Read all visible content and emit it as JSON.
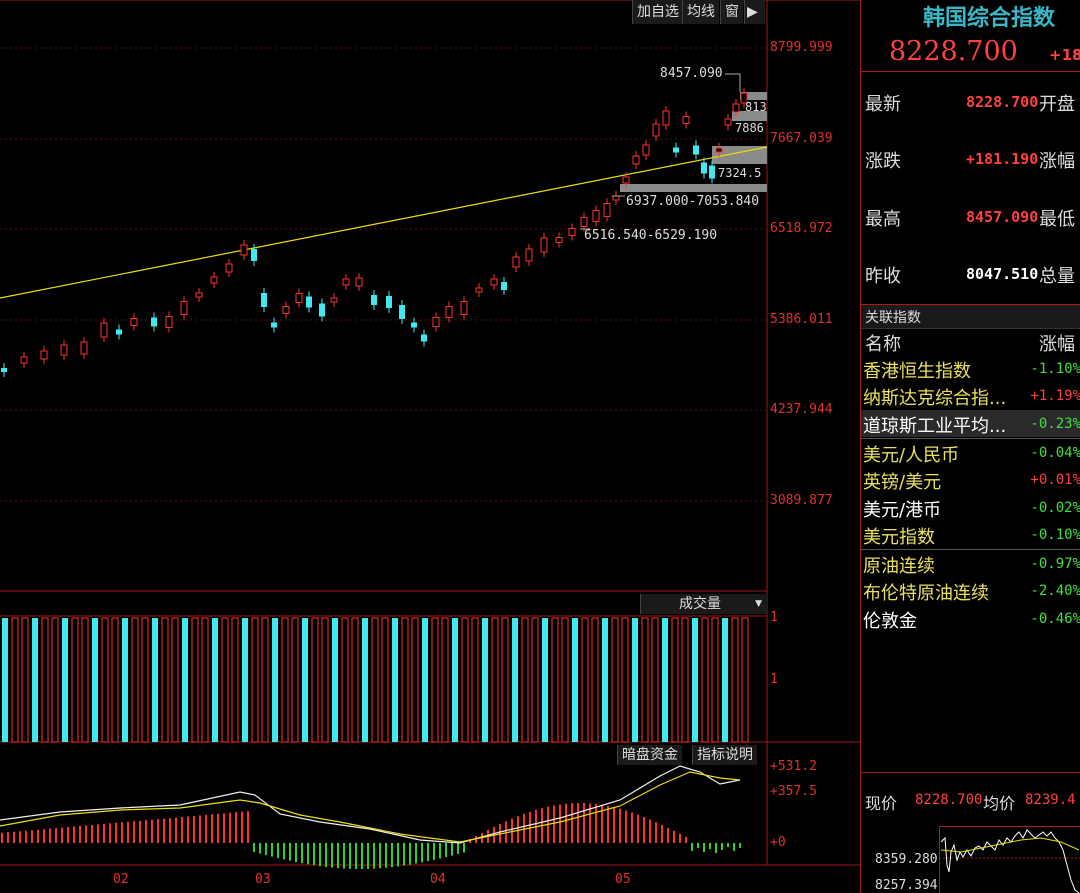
{
  "toolbar": {
    "add_watch": "加自选",
    "ma": "均线",
    "window": "窗"
  },
  "main_chart": {
    "price_axis": [
      "8799.999",
      "7667.039",
      "6518.972",
      "5386.011",
      "4237.944",
      "3089.877"
    ],
    "annotations": {
      "high": "8457.090",
      "gap1": "813",
      "gap2": "7886",
      "gap3": "7324.5",
      "gap4": "6937.000-7053.840",
      "gap5": "6516.540-6529.190"
    }
  },
  "volume_panel": {
    "selector": "成交量",
    "ticks": [
      "1",
      "1"
    ]
  },
  "indicator_panel": {
    "buttons": [
      "暗盘资金",
      "指标说明"
    ],
    "ticks": [
      "+531.2",
      "+357.5",
      "+0"
    ]
  },
  "x_axis": [
    "02",
    "03",
    "04",
    "05"
  ],
  "quote": {
    "title": "韩国综合指数",
    "price": "8228.700",
    "change_partial": "+18",
    "rows": [
      {
        "label": "最新",
        "value": "8228.700",
        "label2": "开盘"
      },
      {
        "label": "涨跌",
        "value": "+181.190",
        "label2": "涨幅"
      },
      {
        "label": "最高",
        "value": "8457.090",
        "label2": "最低"
      },
      {
        "label": "昨收",
        "value": "8047.510",
        "label2": "总量"
      }
    ]
  },
  "related": {
    "header": "关联指数",
    "col_name": "名称",
    "col_change": "涨幅",
    "items": [
      {
        "name": "香港恒生指数",
        "change": "-1.10%",
        "name_color": "#e8e060",
        "change_color": "#40e040"
      },
      {
        "name": "纳斯达克综合指...",
        "change": "+1.19%",
        "name_color": "#e8e060",
        "change_color": "#ff4040"
      },
      {
        "name": "道琼斯工业平均...",
        "change": "-0.23%",
        "name_color": "#ffffff",
        "change_color": "#40e040"
      },
      {
        "name": "美元/人民币",
        "change": "-0.04%",
        "name_color": "#e8e060",
        "change_color": "#40e040"
      },
      {
        "name": "英镑/美元",
        "change": "+0.01%",
        "name_color": "#e8e060",
        "change_color": "#ff4040"
      },
      {
        "name": "美元/港币",
        "change": "-0.02%",
        "name_color": "#ffffff",
        "change_color": "#40e040"
      },
      {
        "name": "美元指数",
        "change": "-0.10%",
        "name_color": "#e8e060",
        "change_color": "#40e040"
      },
      {
        "name": "原油连续",
        "change": "-0.97%",
        "name_color": "#e8e060",
        "change_color": "#40e040"
      },
      {
        "name": "布伦特原油连续",
        "change": "-2.40%",
        "name_color": "#e8e060",
        "change_color": "#40e040"
      },
      {
        "name": "伦敦金",
        "change": "-0.46%",
        "name_color": "#ffffff",
        "change_color": "#40e040"
      }
    ]
  },
  "mini": {
    "now_label": "现价",
    "now_value": "8228.700",
    "avg_label": "均价",
    "avg_value": "8239.4",
    "ticks": [
      "8359.280",
      "8257.394"
    ]
  },
  "colors": {
    "up": "#ff3030",
    "down": "#40e8f0",
    "trend": "#e8e000",
    "grid": "#a01818"
  }
}
